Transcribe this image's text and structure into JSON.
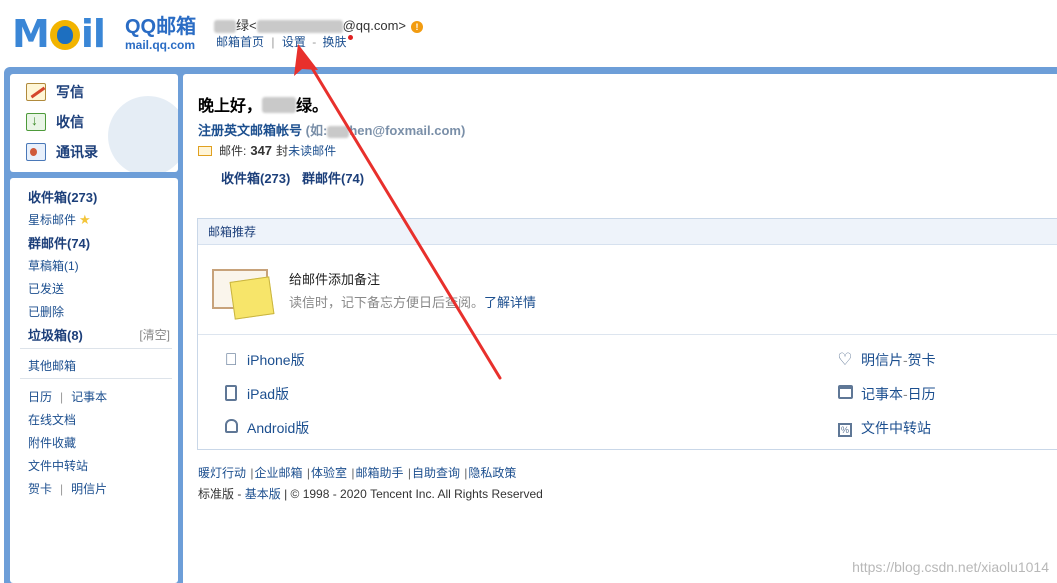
{
  "header": {
    "logo_text": "MOil",
    "brand_text": "QQ邮箱",
    "domain_text": "mail.qq.com",
    "user_name_suffix": "绿<",
    "user_email_suffix": "@qq.com>",
    "warn_symbol": "!",
    "links": {
      "home": "邮箱首页",
      "settings": "设置",
      "dash": "-",
      "skin": "换肤"
    }
  },
  "sidebar": {
    "quick": {
      "write": "写信",
      "receive": "收信",
      "contacts": "通讯录"
    },
    "folders": {
      "inbox": "收件箱(273)",
      "starred": "星标邮件",
      "groups": "群邮件(74)",
      "drafts": "草稿箱(1)",
      "sent": "已发送",
      "deleted": "已删除",
      "junk": "垃圾箱(8)",
      "clear": "[清空]",
      "other": "其他邮箱",
      "calendar": "日历",
      "notes": "记事本",
      "docs": "在线文档",
      "attachments": "附件收藏",
      "transfer": "文件中转站",
      "greeting_card": "贺卡",
      "postcard": "明信片",
      "sep": "|"
    }
  },
  "main": {
    "greeting_prefix": "晚上好，",
    "greeting_suffix": "绿。",
    "register_text": "注册英文邮箱帐号",
    "register_hint_prefix": "(如:",
    "register_hint_suffix": "hen@foxmail.com)",
    "mail_label": "邮件:",
    "mail_count": "347",
    "mail_unit": "封",
    "unread_label": "未读邮件",
    "inbox_link": "收件箱(273)",
    "groups_link": "群邮件(74)",
    "recommend": {
      "title": "邮箱推荐",
      "feature_title": "给邮件添加备注",
      "feature_desc": "读信时，记下备忘方便日后查阅。",
      "feature_more": "了解详情"
    },
    "apps": {
      "iphone": "iPhone版",
      "ipad": "iPad版",
      "android": "Android版",
      "card_a": "明信片",
      "card_sep": " - ",
      "card_b": "贺卡",
      "note_a": "记事本",
      "note_b": "日历",
      "transfer": "文件中转站"
    },
    "footer": {
      "links": [
        "暖灯行动",
        "企业邮箱",
        "体验室",
        "邮箱助手",
        "自助查询",
        "隐私政策"
      ],
      "bar": "|",
      "edition_std": "标准版",
      "edition_dash": "-",
      "edition_basic": "基本版",
      "copyright": "| © 1998 - 2020 Tencent Inc. All Rights Reserved"
    }
  },
  "watermark": "https://blog.csdn.net/xiaolu1014",
  "colors": {
    "frame": "#6d9ed8",
    "link": "#1c4f8f",
    "arrow": "#e8302c"
  }
}
